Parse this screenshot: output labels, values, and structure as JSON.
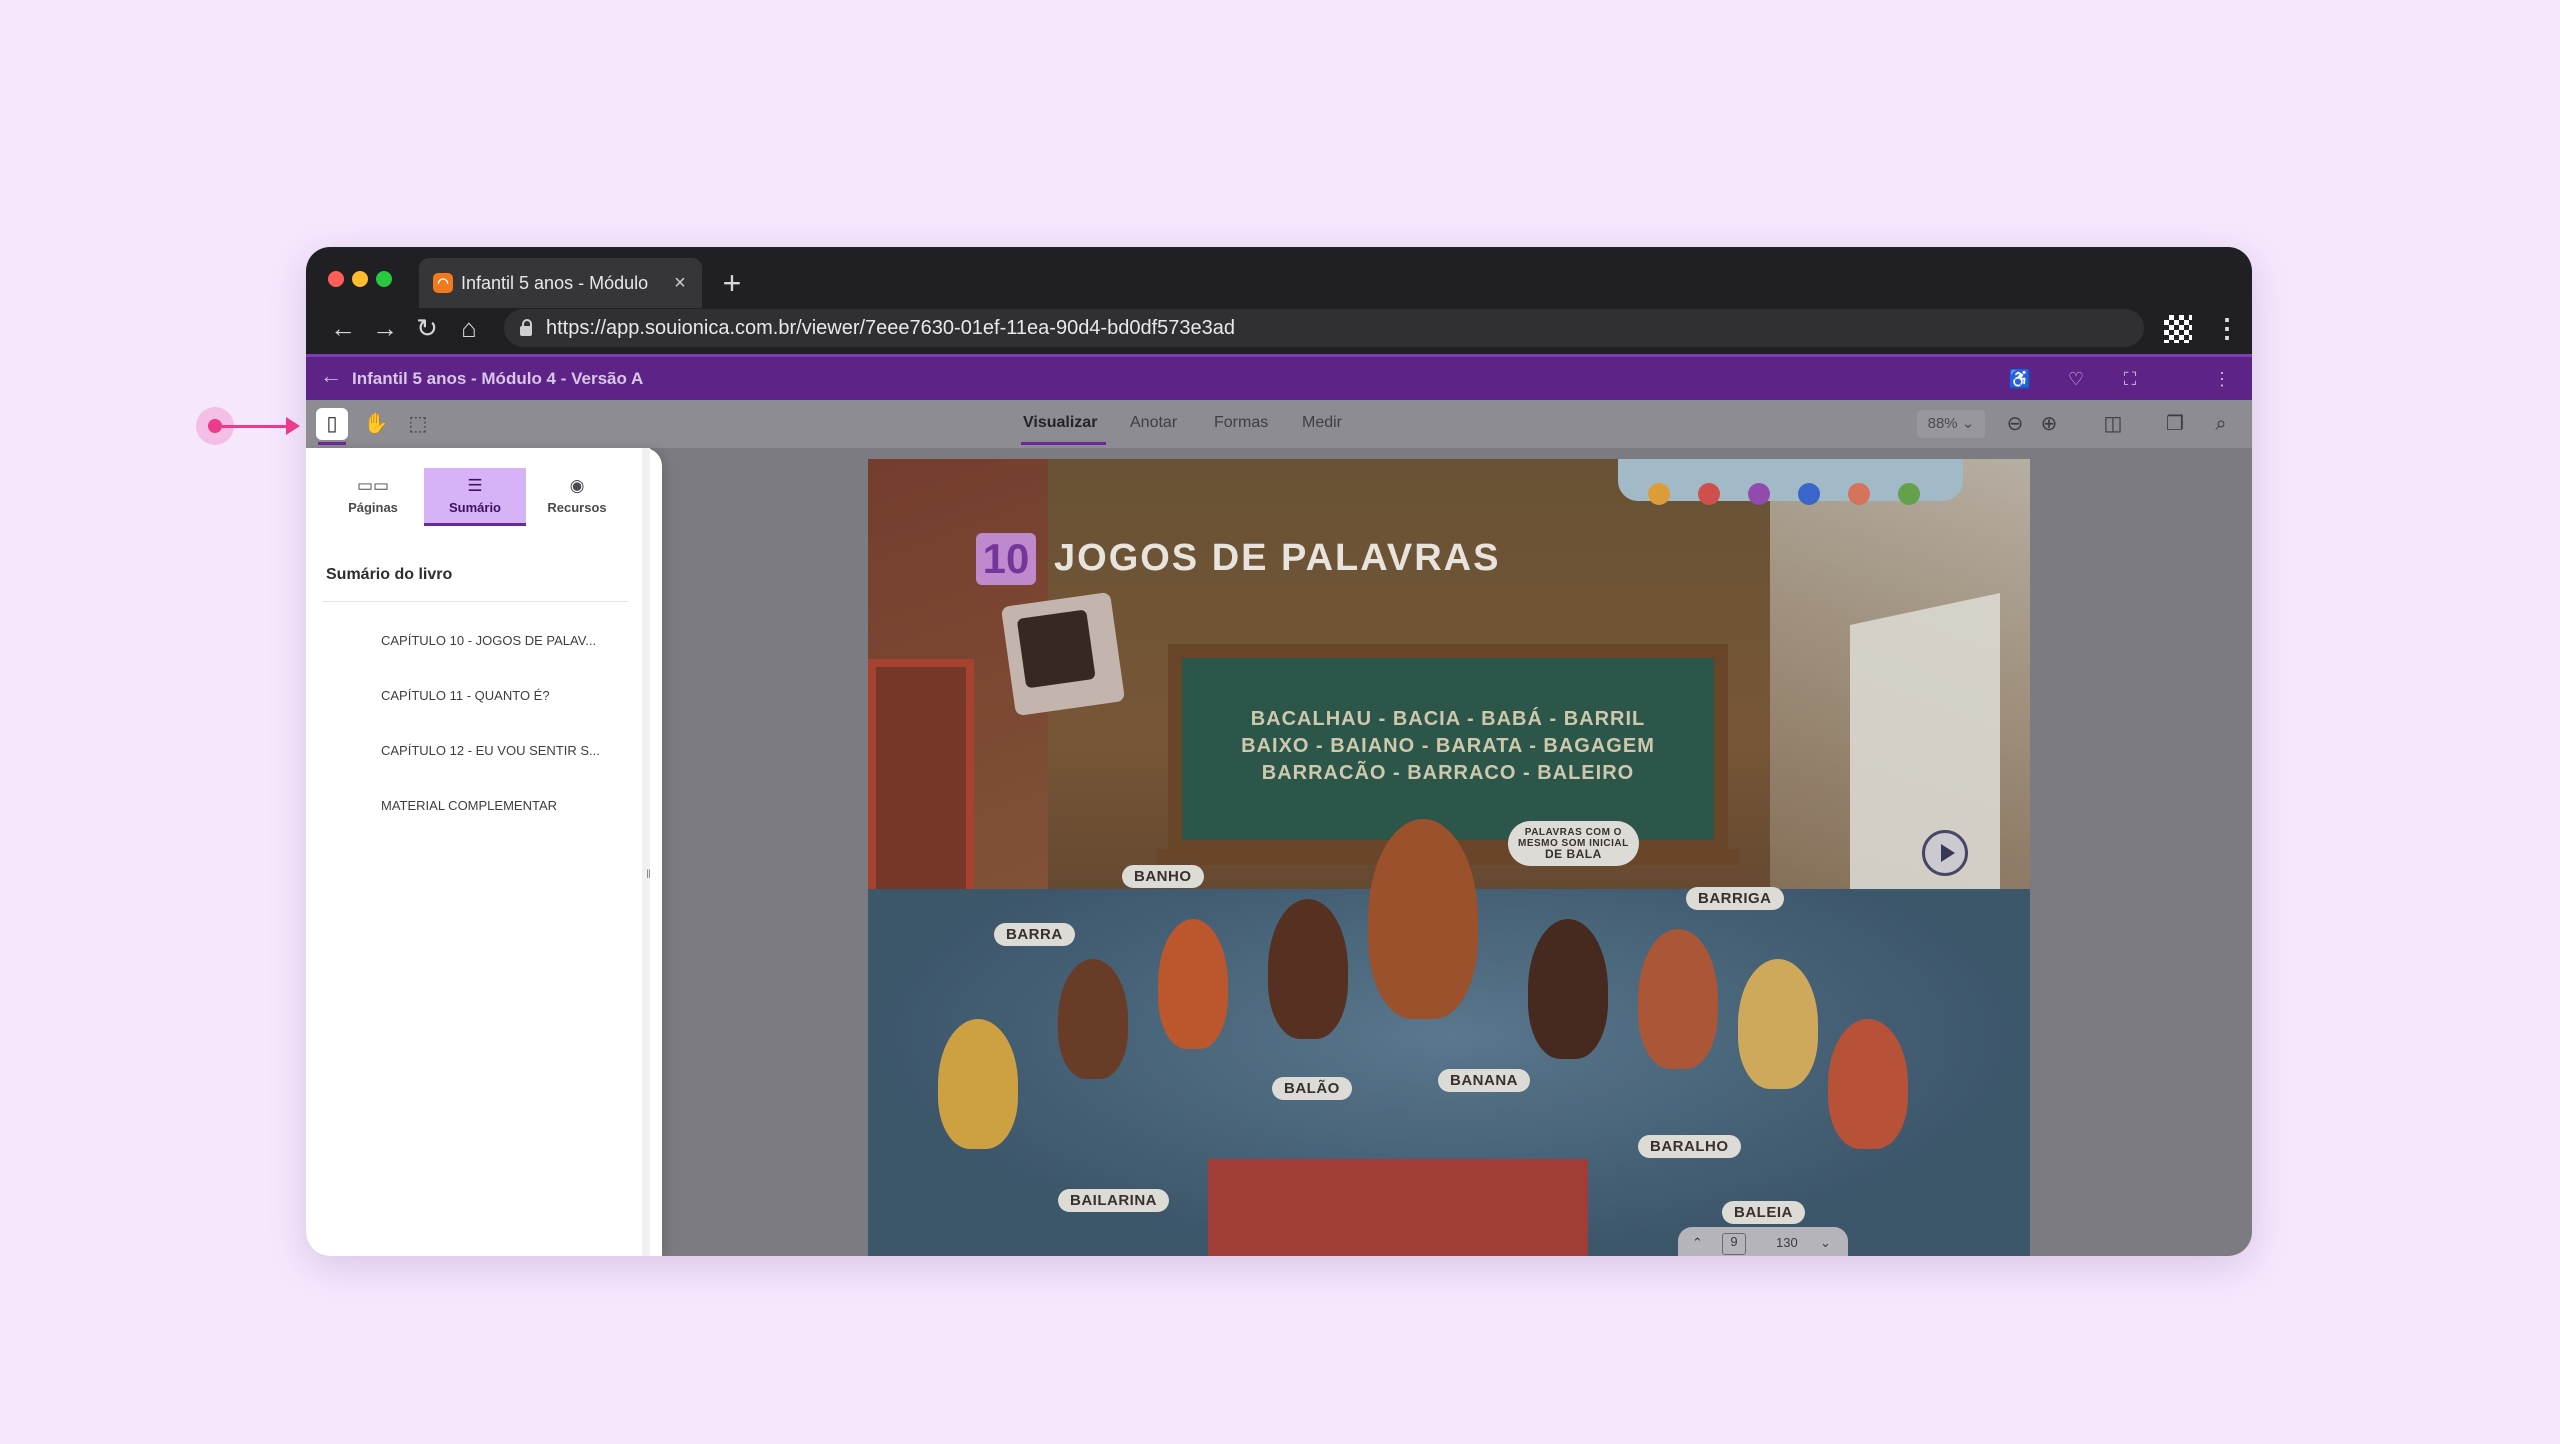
{
  "browser": {
    "tab_title": "Infantil 5 anos - Módulo",
    "tab_favicon": "orange-app-icon",
    "url": "https://app.souionica.com.br/viewer/7eee7630-01ef-11ea-90d4-bd0df573e3ad",
    "traffic_lights": {
      "close": "#ff5f57",
      "minimize": "#febc2e",
      "maximize": "#28c840"
    }
  },
  "app": {
    "title": "Infantil 5 anos - Módulo 4 - Versão A",
    "accent": "#5d2386"
  },
  "toolbar": {
    "modes": [
      "Visualizar",
      "Anotar",
      "Formas",
      "Medir"
    ],
    "active_mode": "Visualizar",
    "zoom": "88%"
  },
  "sidebar": {
    "tabs": [
      {
        "label": "Páginas",
        "icon": "pages-icon"
      },
      {
        "label": "Sumário",
        "icon": "list-icon"
      },
      {
        "label": "Recursos",
        "icon": "play-circle-icon"
      }
    ],
    "active_tab": "Sumário",
    "summary_title": "Sumário do livro",
    "chapters": [
      "CAPÍTULO 10 - JOGOS DE PALAV...",
      "CAPÍTULO 11 - QUANTO É?",
      "CAPÍTULO 12 - EU VOU SENTIR S...",
      "MATERIAL COMPLEMENTAR"
    ]
  },
  "page": {
    "chapter_number": "10",
    "title": "JOGOS DE PALAVRAS",
    "board_lines": [
      "BACALHAU - BACIA - BABÁ - BARRIL",
      "BAIXO - BAIANO - BARATA - BAGAGEM",
      "BARRACÃO - BARRACO - BALEIRO"
    ],
    "teacher_bubble": [
      "PALAVRAS COM O",
      "MESMO SOM INICIAL",
      "DE BALA"
    ],
    "word_bubbles": [
      "BANHO",
      "BARRA",
      "BARRIGA",
      "BALÃO",
      "BANANA",
      "BARALHO",
      "BAILARINA",
      "BALEIA"
    ]
  },
  "pager": {
    "current": "9",
    "total": "130"
  }
}
